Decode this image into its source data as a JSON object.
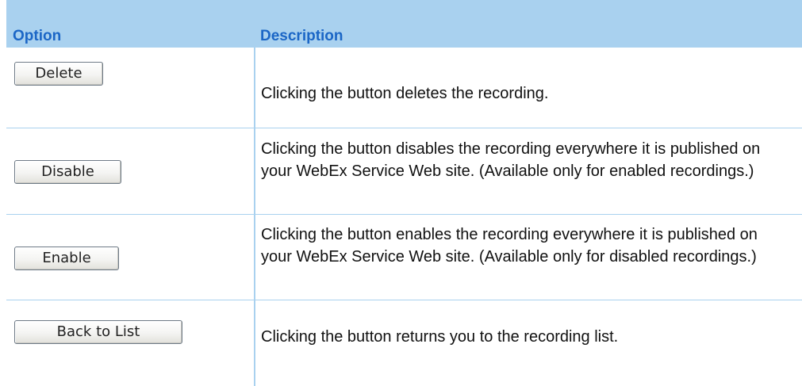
{
  "header": {
    "option": "Option",
    "description": "Description"
  },
  "rows": [
    {
      "button": "Delete",
      "description": "Clicking the button deletes the recording."
    },
    {
      "button": "Disable",
      "description": "Clicking the button disables the recording everywhere it is published on your WebEx Service Web site. (Available only for enabled recordings.)"
    },
    {
      "button": "Enable",
      "description": "Clicking the button enables the recording everywhere it is published on your WebEx Service Web site. (Available only for disabled recordings.)"
    },
    {
      "button": "Back to List",
      "description": "Clicking the button returns you to the recording list."
    }
  ]
}
